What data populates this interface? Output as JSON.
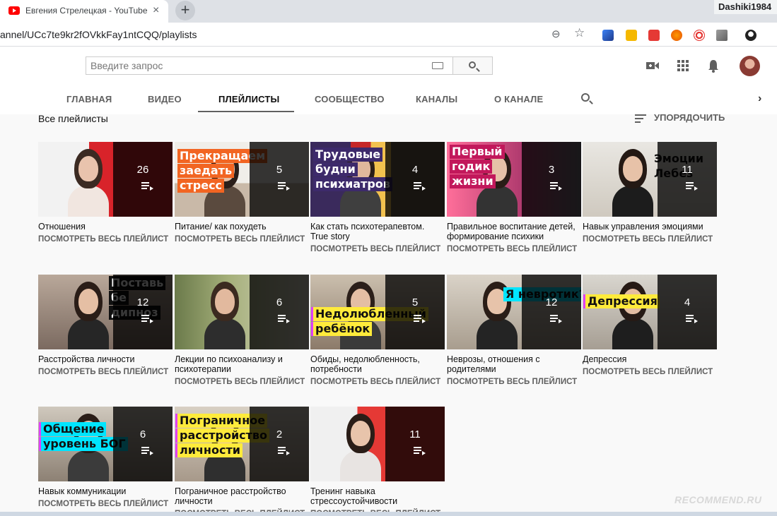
{
  "browser": {
    "tab_title": "Евгения Стрелецкая - YouTube",
    "tab_close": "×",
    "new_tab": "+",
    "window_user": "Dashiki1984",
    "url": "annel/UCc7te9kr2fOVkkFay1ntCQQ/playlists",
    "zoom_icon": "⊖",
    "star_icon": "☆"
  },
  "masthead": {
    "search_placeholder": "Введите запрос"
  },
  "channel_tabs": {
    "items": [
      "ГЛАВНАЯ",
      "ВИДЕО",
      "ПЛЕЙЛИСТЫ",
      "СООБЩЕСТВО",
      "КАНАЛЫ",
      "О КАНАЛЕ"
    ],
    "active": "ПЛЕЙЛИСТЫ",
    "next": "›"
  },
  "section": {
    "title": "Все плейлисты",
    "sort_label": "УПОРЯДОЧИТЬ"
  },
  "view_all_label": "ПОСМОТРЕТЬ ВЕСЬ ПЛЕЙЛИСТ",
  "playlists": [
    {
      "title": "Отношения",
      "count": "26",
      "caption": []
    },
    {
      "title": "Питание/ как похудеть",
      "count": "5",
      "caption": [
        "Прекращаем",
        "заедать",
        "стресс"
      ]
    },
    {
      "title": "Как стать психотерапевтом. True story",
      "count": "4",
      "caption": [
        "Трудовые",
        "будни",
        "психиатров"
      ]
    },
    {
      "title": "Правильное воспитание детей, формирование психики",
      "count": "3",
      "caption": [
        "Первый",
        "годик",
        "жизни"
      ]
    },
    {
      "title": "Навык управления эмоциями",
      "count": "11",
      "caption": [
        "Эмоции",
        "Лебез"
      ]
    },
    {
      "title": "Расстройства личности",
      "count": "12",
      "caption": [
        "Поставь",
        "бе",
        "дипноз"
      ]
    },
    {
      "title": "Лекции по психоанализу и психотерапии",
      "count": "6",
      "caption": []
    },
    {
      "title": "Обиды, недолюбленность, потребности",
      "count": "5",
      "caption": [
        "Недолюбленный",
        "ребёнок"
      ]
    },
    {
      "title": "Неврозы, отношения с родителями",
      "count": "12",
      "caption": [
        "Я невротик?"
      ]
    },
    {
      "title": "Депрессия",
      "count": "4",
      "caption": [
        "Депрессия"
      ]
    },
    {
      "title": "Навык коммуникации",
      "count": "6",
      "caption": [
        "Общение",
        "уровень БОГ"
      ]
    },
    {
      "title": "Пограничное расстройство личности",
      "count": "2",
      "caption": [
        "Пограничное",
        "расстройство",
        "личности"
      ]
    },
    {
      "title": "Тренинг навыка стрессоустойчивости",
      "count": "11",
      "caption": []
    }
  ],
  "watermark": "RECOMMEND.RU"
}
